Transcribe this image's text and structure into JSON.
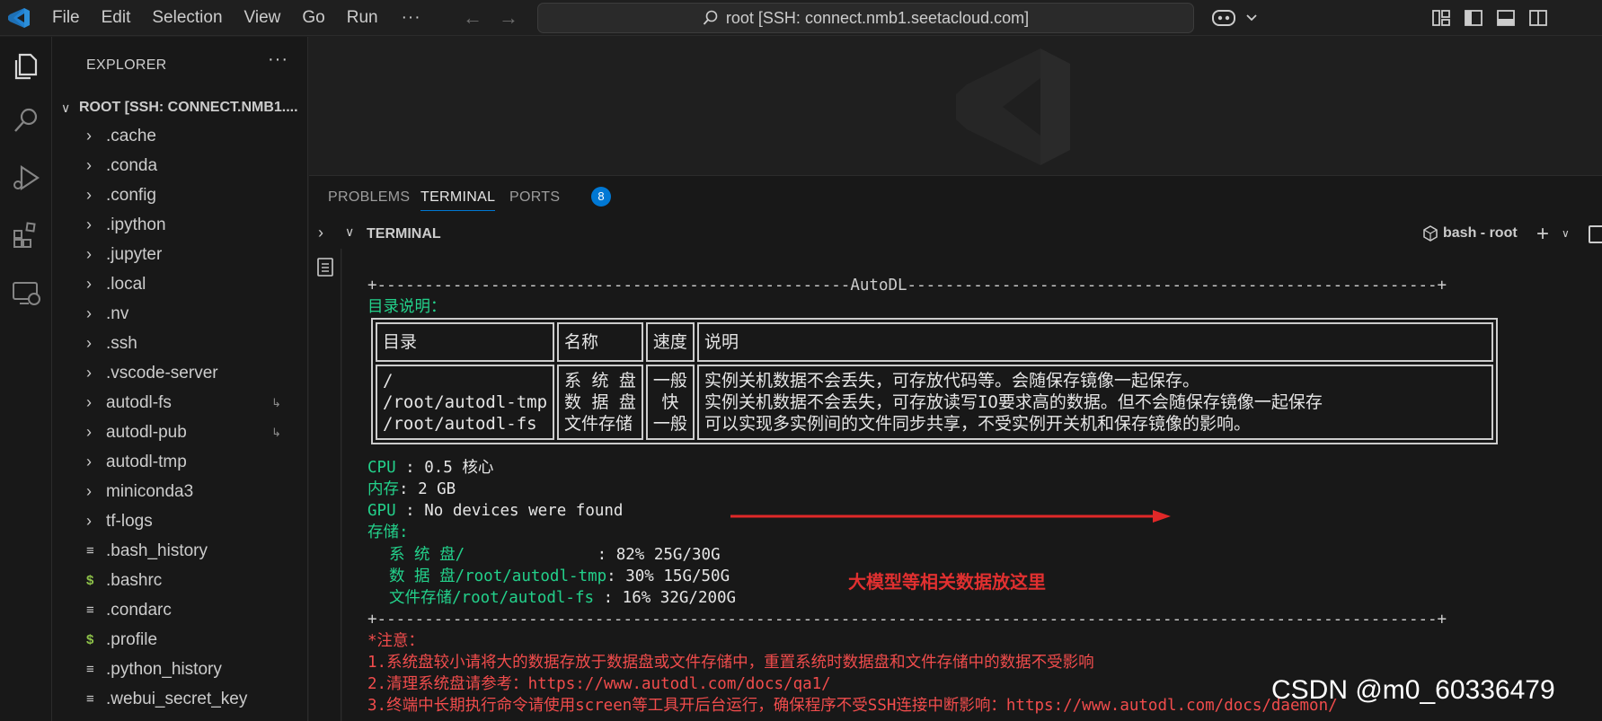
{
  "menu": [
    "File",
    "Edit",
    "Selection",
    "View",
    "Go",
    "Run"
  ],
  "menu_more": "···",
  "search": {
    "text": "root [SSH: connect.nmb1.seetacloud.com]"
  },
  "explorer": {
    "header": "EXPLORER",
    "more": "···",
    "root_label": "ROOT [SSH: CONNECT.NMB1....",
    "items": [
      {
        "label": ".cache",
        "kind": "folder"
      },
      {
        "label": ".conda",
        "kind": "folder"
      },
      {
        "label": ".config",
        "kind": "folder"
      },
      {
        "label": ".ipython",
        "kind": "folder"
      },
      {
        "label": ".jupyter",
        "kind": "folder"
      },
      {
        "label": ".local",
        "kind": "folder"
      },
      {
        "label": ".nv",
        "kind": "folder"
      },
      {
        "label": ".ssh",
        "kind": "folder"
      },
      {
        "label": ".vscode-server",
        "kind": "folder"
      },
      {
        "label": "autodl-fs",
        "kind": "folder-link"
      },
      {
        "label": "autodl-pub",
        "kind": "folder-link"
      },
      {
        "label": "autodl-tmp",
        "kind": "folder"
      },
      {
        "label": "miniconda3",
        "kind": "folder"
      },
      {
        "label": "tf-logs",
        "kind": "folder"
      },
      {
        "label": ".bash_history",
        "kind": "file"
      },
      {
        "label": ".bashrc",
        "kind": "shell"
      },
      {
        "label": ".condarc",
        "kind": "file"
      },
      {
        "label": ".profile",
        "kind": "shell"
      },
      {
        "label": ".python_history",
        "kind": "file"
      },
      {
        "label": ".webui_secret_key",
        "kind": "file"
      }
    ]
  },
  "panel": {
    "tabs": [
      "PROBLEMS",
      "TERMINAL",
      "PORTS"
    ],
    "active_tab": "TERMINAL",
    "ports_count": "8"
  },
  "terminal": {
    "header_title": "TERMINAL",
    "shell_label": "bash - root",
    "top_border": "+--------------------------------------------------AutoDL--------------------------------------------------------+",
    "dir_title": "目录说明：",
    "table": {
      "headers": [
        "目录",
        "名称",
        "速度",
        "说明"
      ],
      "dirs": [
        "/",
        "/root/autodl-tmp",
        "/root/autodl-fs"
      ],
      "names": [
        "系 统 盘",
        "数 据 盘",
        "文件存储"
      ],
      "speeds": [
        "一般",
        "快",
        "一般"
      ],
      "descs": [
        "实例关机数据不会丢失，可存放代码等。会随保存镜像一起保存。",
        "实例关机数据不会丢失，可存放读写IO要求高的数据。但不会随保存镜像一起保存",
        "可以实现多实例间的文件同步共享，不受实例开关机和保存镜像的影响。"
      ]
    },
    "cpu_label": "CPU",
    "cpu_value": " : 0.5 核心",
    "mem_label": "内存",
    "mem_value": ": 2 GB",
    "gpu_label": "GPU",
    "gpu_value": " : No devices were found",
    "storage_label": "存储:",
    "storage": [
      {
        "name": "系 统 盘",
        "path": "/",
        "pad": "              ",
        "value": ": 82% 25G/30G"
      },
      {
        "name": "数 据 盘",
        "path": "/root/autodl-tmp",
        "pad": "",
        "value": ": 30% 15G/50G"
      },
      {
        "name": "文件存储",
        "path": "/root/autodl-fs",
        "pad": " ",
        "value": ": 16% 32G/200G"
      }
    ],
    "bottom_border": "+----------------------------------------------------------------------------------------------------------------+",
    "notes_title": "*注意：",
    "notes": [
      "1.系统盘较小请将大的数据存放于数据盘或文件存储中，重置系统时数据盘和文件存储中的数据不受影响",
      "2.清理系统盘请参考：https://www.autodl.com/docs/qa1/",
      "3.终端中长期执行命令请使用screen等工具开后台运行，确保程序不受SSH连接中断影响：https://www.autodl.com/docs/daemon/"
    ]
  },
  "annotation": "大模型等相关数据放这里",
  "watermark_text": "CSDN @m0_60336479"
}
